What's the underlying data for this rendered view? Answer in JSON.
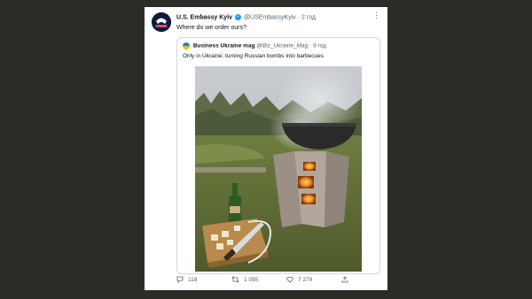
{
  "tweet": {
    "author_name": "U.S. Embassy Kyiv",
    "author_handle": "@USEmbassyKyiv",
    "time": "2 год",
    "text": "Where do we order ours?",
    "avatar_label": "UKRAINE"
  },
  "quote": {
    "author_name": "Business Ukraine mag",
    "author_handle": "@Biz_Ukraine_Mag",
    "time": "9 год",
    "text": "Only in Ukraine: turning Russian bombs into barbecues"
  },
  "actions": {
    "replies": "118",
    "retweets": "1 095",
    "likes": "7 279"
  },
  "icons": {
    "verified": "verified-badge-icon",
    "more": "more-dots-icon",
    "reply": "reply-icon",
    "retweet": "retweet-icon",
    "like": "heart-icon",
    "share": "share-icon"
  },
  "colors": {
    "background": "#2b2b28",
    "card": "#ffffff",
    "verified": "#1d9bf0",
    "text_primary": "#0f1419",
    "text_secondary": "#536471"
  }
}
